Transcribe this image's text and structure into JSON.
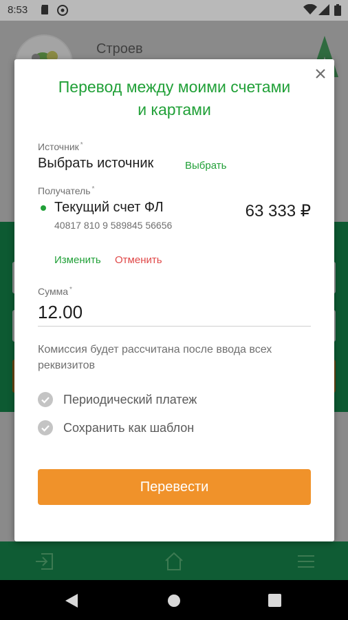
{
  "status_bar": {
    "time": "8:53"
  },
  "background": {
    "username": "Строев"
  },
  "modal": {
    "title_line1": "Перевод между моими счетами",
    "title_line2": "и картами",
    "source": {
      "label": "Источник",
      "required_mark": "*",
      "value": "Выбрать источник",
      "select_link": "Выбрать"
    },
    "recipient": {
      "label": "Получатель",
      "required_mark": "*",
      "account_name": "Текущий счет ФЛ",
      "account_number": "40817 810 9 589845 56656",
      "balance": "63 333 ₽",
      "change_label": "Изменить",
      "cancel_label": "Отменить"
    },
    "amount": {
      "label": "Сумма",
      "required_mark": "*",
      "value": "12.00"
    },
    "commission_text": "Комиссия будет рассчитана после ввода всех реквизитов",
    "options": [
      {
        "label": "Периодический платеж",
        "checked": false
      },
      {
        "label": "Сохранить как шаблон",
        "checked": false
      }
    ],
    "submit_label": "Перевести"
  },
  "colors": {
    "accent_green": "#21a038",
    "submit_orange": "#f0922a",
    "cancel_red": "#e04848"
  }
}
